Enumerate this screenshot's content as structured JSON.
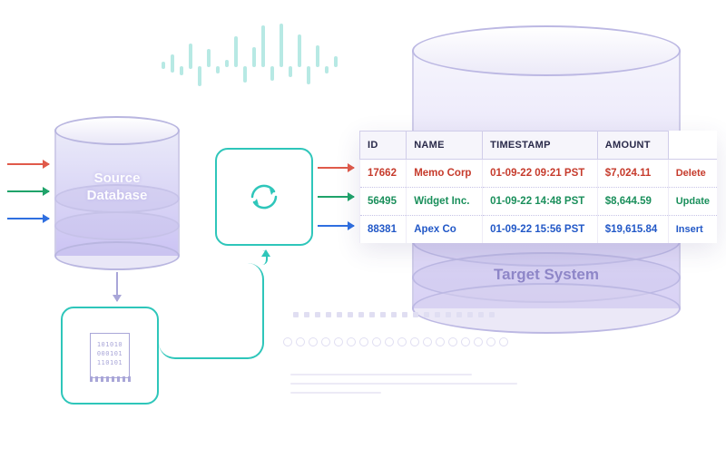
{
  "source_label_l1": "Source",
  "source_label_l2": "Database",
  "target_label": "Target System",
  "binlog_bits_l1": "101010",
  "binlog_bits_l2": "000101",
  "binlog_bits_l3": "110101",
  "table": {
    "headers": {
      "id": "ID",
      "name": "NAME",
      "ts": "TIMESTAMP",
      "amount": "AMOUNT"
    },
    "rows": [
      {
        "id": "17662",
        "name": "Memo Corp",
        "ts": "01-09-22 09:21 PST",
        "amount": "$7,024.11",
        "action": "Delete",
        "cls": "c-del"
      },
      {
        "id": "56495",
        "name": "Widget Inc.",
        "ts": "01-09-22 14:48 PST",
        "amount": "$8,644.59",
        "action": "Update",
        "cls": "c-upd"
      },
      {
        "id": "88381",
        "name": "Apex Co",
        "ts": "01-09-22 15:56 PST",
        "amount": "$19,615.84",
        "action": "Insert",
        "cls": "c-ins"
      }
    ]
  },
  "colors": {
    "delete": "#c63b2c",
    "update": "#1a8f5b",
    "insert": "#2258c7",
    "teal": "#2ec6ba",
    "lavender": "#a9a6d8"
  }
}
